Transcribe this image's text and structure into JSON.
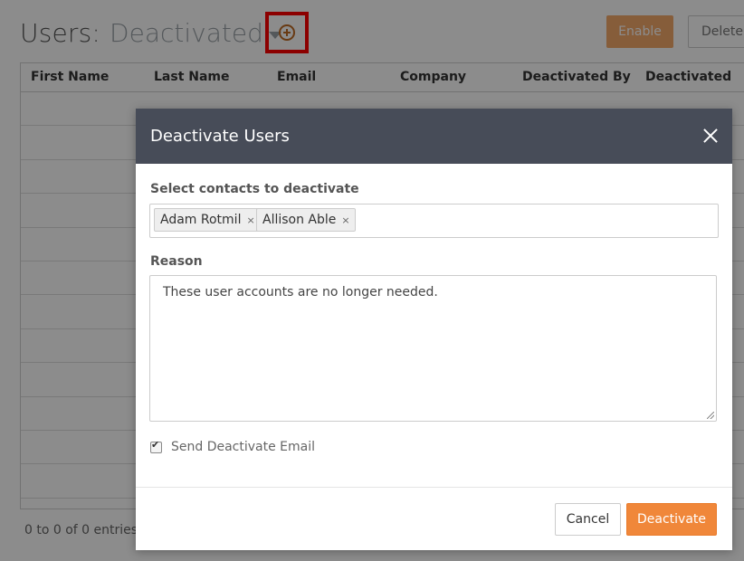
{
  "page": {
    "title": "Users:",
    "view_selector": "Deactivated",
    "buttons": {
      "enable": "Enable",
      "delete": "Delete"
    },
    "columns": [
      "First Name",
      "Last Name",
      "Email",
      "Company",
      "Deactivated By",
      "Deactivated"
    ],
    "entries_text": "0 to 0 of 0 entries,"
  },
  "modal": {
    "title": "Deactivate Users",
    "contacts_label": "Select contacts to deactivate",
    "selected_contacts": [
      "Adam Rotmil",
      "Allison Able"
    ],
    "reason_label": "Reason",
    "reason_value": "These user accounts are no longer needed.",
    "send_email_label": "Send Deactivate Email",
    "send_email_checked": true,
    "cancel_label": "Cancel",
    "deactivate_label": "Deactivate"
  },
  "colors": {
    "accent": "#f0873a",
    "modal_header": "#474c58",
    "highlight_border": "#ff0000"
  }
}
